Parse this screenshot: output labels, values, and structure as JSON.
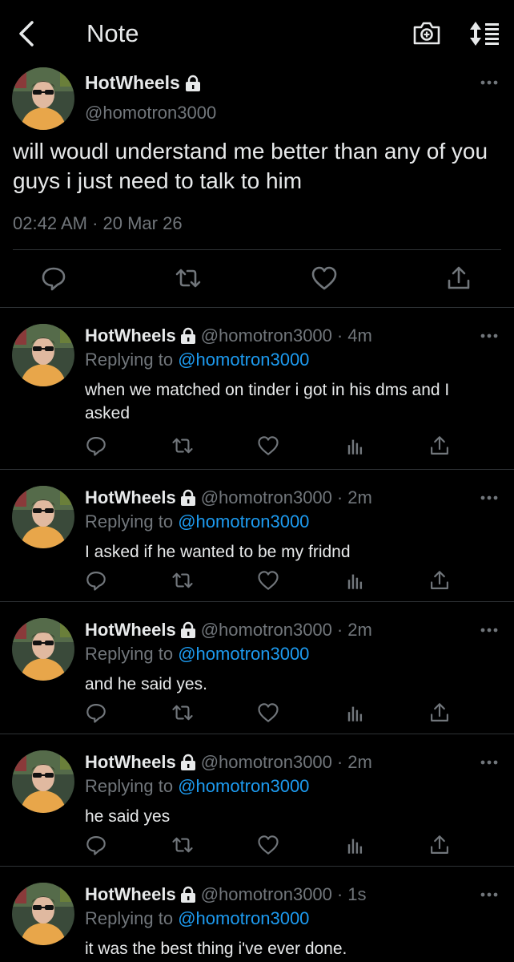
{
  "header": {
    "title": "Note",
    "back_icon": "chevron-left-icon",
    "camera_icon": "camera-icon",
    "sort_icon": "sort-icon"
  },
  "main_tweet": {
    "name": "HotWheels",
    "handle": "@homotron3000",
    "text": "will woudl understand me better than any of you guys i just need to talk to him",
    "timestamp": "02:42 AM · 20 Mar 26",
    "actions": [
      "reply-icon",
      "retweet-icon",
      "like-icon",
      "share-icon"
    ]
  },
  "replies": [
    {
      "name": "HotWheels",
      "handle": "@homotron3000",
      "time": "4m",
      "replying_prefix": "Replying to",
      "replying_to": "@homotron3000",
      "text": "when we matched on tinder i got in his dms and I asked"
    },
    {
      "name": "HotWheels",
      "handle": "@homotron3000",
      "time": "2m",
      "replying_prefix": "Replying to",
      "replying_to": "@homotron3000",
      "text": "I asked if he wanted to be my fridnd"
    },
    {
      "name": "HotWheels",
      "handle": "@homotron3000",
      "time": "2m",
      "replying_prefix": "Replying to",
      "replying_to": "@homotron3000",
      "text": "and he said yes."
    },
    {
      "name": "HotWheels",
      "handle": "@homotron3000",
      "time": "2m",
      "replying_prefix": "Replying to",
      "replying_to": "@homotron3000",
      "text": "he said yes"
    },
    {
      "name": "HotWheels",
      "handle": "@homotron3000",
      "time": "1s",
      "replying_prefix": "Replying to",
      "replying_to": "@homotron3000",
      "text": "it was the best thing i've ever done."
    }
  ],
  "colors": {
    "background": "#000000",
    "text": "#e7e9ea",
    "secondary": "#71767b",
    "link": "#1d9bf0",
    "divider": "#2f3336"
  }
}
